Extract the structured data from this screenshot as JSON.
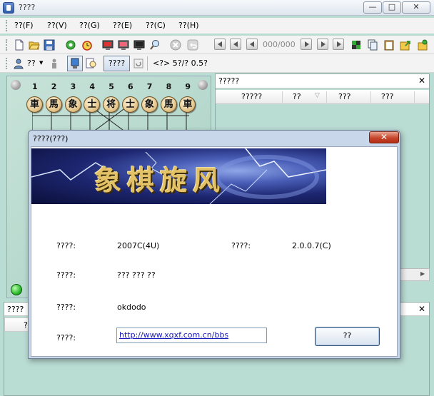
{
  "window": {
    "title": "????"
  },
  "menu": [
    "??(F)",
    "??(V)",
    "??(G)",
    "??(E)",
    "??(C)",
    "??(H)"
  ],
  "toolbar1": {
    "counter": "000/000"
  },
  "toolbar2": {
    "dropdown": "??",
    "mode_label": "????",
    "status_text": "<?> 5?/? 0.5?"
  },
  "board": {
    "columns": [
      "1",
      "2",
      "3",
      "4",
      "5",
      "6",
      "7",
      "8",
      "9"
    ],
    "pieces": [
      "車",
      "馬",
      "象",
      "士",
      "将",
      "士",
      "象",
      "馬",
      "車"
    ]
  },
  "list_panel": {
    "title": "?????",
    "columns": [
      "?????",
      "??",
      "???",
      "???"
    ]
  },
  "bottom_panel": {
    "title": "????",
    "strip": "??"
  },
  "dialog": {
    "title": "????(???)",
    "close_label": "✕",
    "banner_text": "象棋旋风",
    "rows": [
      {
        "label": "????:",
        "value": "2007C(4U)"
      },
      {
        "label": "????:",
        "value": "2.0.0.7(C)"
      },
      {
        "label": "????:",
        "value": "??? ??? ??"
      },
      {
        "label": "????:",
        "value": "okdodo"
      },
      {
        "label": "????:",
        "value": "http://www.xqxf.com.cn/bbs"
      }
    ],
    "ok_label": "??"
  },
  "colors": {
    "background": "#b9dcd3",
    "dialog_frame": "#c9d7ea",
    "close_red": "#c7472c"
  }
}
